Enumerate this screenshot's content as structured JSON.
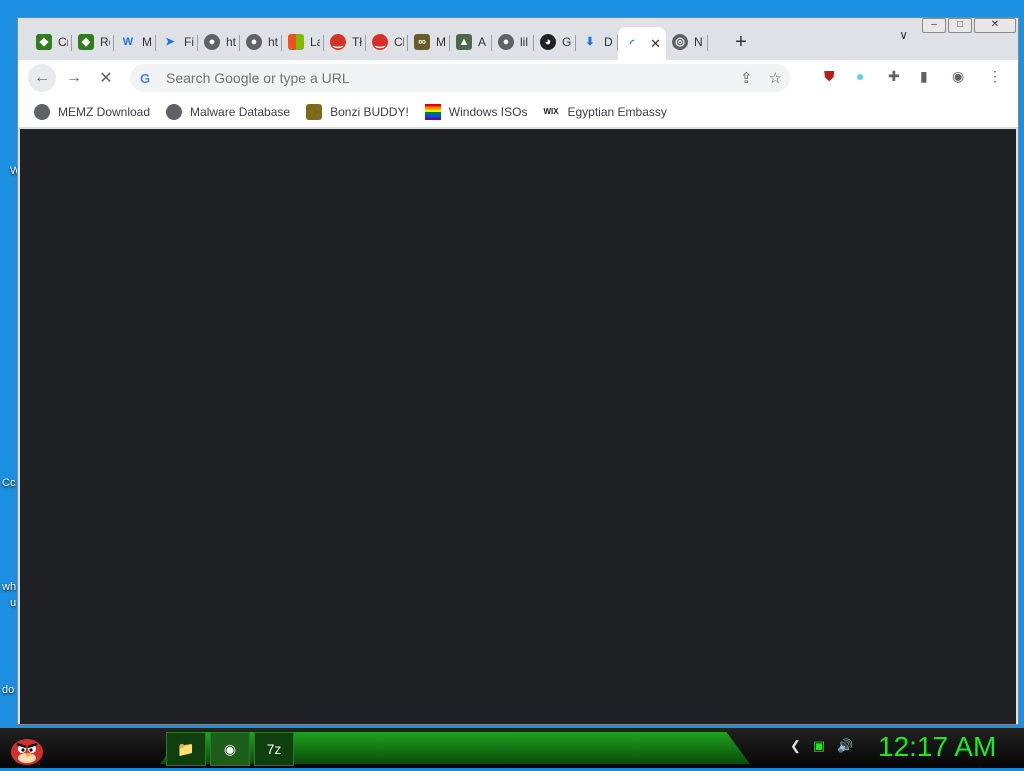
{
  "desktop": {
    "fragments": [
      "W",
      "Cc",
      "wh",
      "u",
      "do"
    ]
  },
  "window_controls": {
    "minimize": "–",
    "maximize": "□",
    "close": "✕"
  },
  "tabs": [
    {
      "label": "Cr",
      "icon": "shield-green-icon",
      "color": "#2f7d1e"
    },
    {
      "label": "Re",
      "icon": "shield-green-icon",
      "color": "#2f7d1e"
    },
    {
      "label": "M",
      "icon": "w-letter-icon",
      "color": "#1a73e8"
    },
    {
      "label": "Fi",
      "icon": "bird-icon",
      "color": "#1a73e8"
    },
    {
      "label": "ht",
      "icon": "globe-icon",
      "color": "#5f6368"
    },
    {
      "label": "ht",
      "icon": "globe-icon",
      "color": "#5f6368"
    },
    {
      "label": "La",
      "icon": "windows-logo-icon",
      "color": "#f25022"
    },
    {
      "label": "Tł",
      "icon": "lips-icon",
      "color": "#d93025"
    },
    {
      "label": "Cl",
      "icon": "lips-icon",
      "color": "#d93025"
    },
    {
      "label": "M",
      "icon": "infinity-icon",
      "color": "#6b5a2a"
    },
    {
      "label": "A",
      "icon": "landscape-icon",
      "color": "#4a6b4a"
    },
    {
      "label": "lil",
      "icon": "globe-icon",
      "color": "#5f6368"
    },
    {
      "label": "G",
      "icon": "github-icon",
      "color": "#202124"
    },
    {
      "label": "D",
      "icon": "download-icon",
      "color": "#1a73e8"
    }
  ],
  "active_tab": {
    "label": "",
    "close": "✕"
  },
  "last_tab": {
    "label": "N",
    "icon": "chrome-icon"
  },
  "new_tab_label": "+",
  "tab_search_label": "∨",
  "toolbar": {
    "back": "←",
    "forward": "→",
    "stop": "✕",
    "omnibox_placeholder": "Search Google or type a URL",
    "menu": "⋮"
  },
  "bookmarks": [
    {
      "label": "MEMZ Download",
      "icon": "globe-icon",
      "color": "#5f6368"
    },
    {
      "label": "Malware Database",
      "icon": "globe-icon",
      "color": "#5f6368"
    },
    {
      "label": "Bonzi BUDDY!",
      "icon": "bonzi-icon",
      "color": "#7a6a1a"
    },
    {
      "label": "Windows ISOs",
      "icon": "rainbow-flag-icon",
      "color": "#e040a0"
    },
    {
      "label": "Egyptian Embassy",
      "icon": "wix-icon",
      "color": "#202124"
    }
  ],
  "taskbar": {
    "clock": "12:17 AM",
    "items": [
      "file-explorer-icon",
      "chrome-icon",
      "7zip-icon"
    ],
    "item_glyphs": [
      "📁",
      "◉",
      "7z"
    ]
  }
}
